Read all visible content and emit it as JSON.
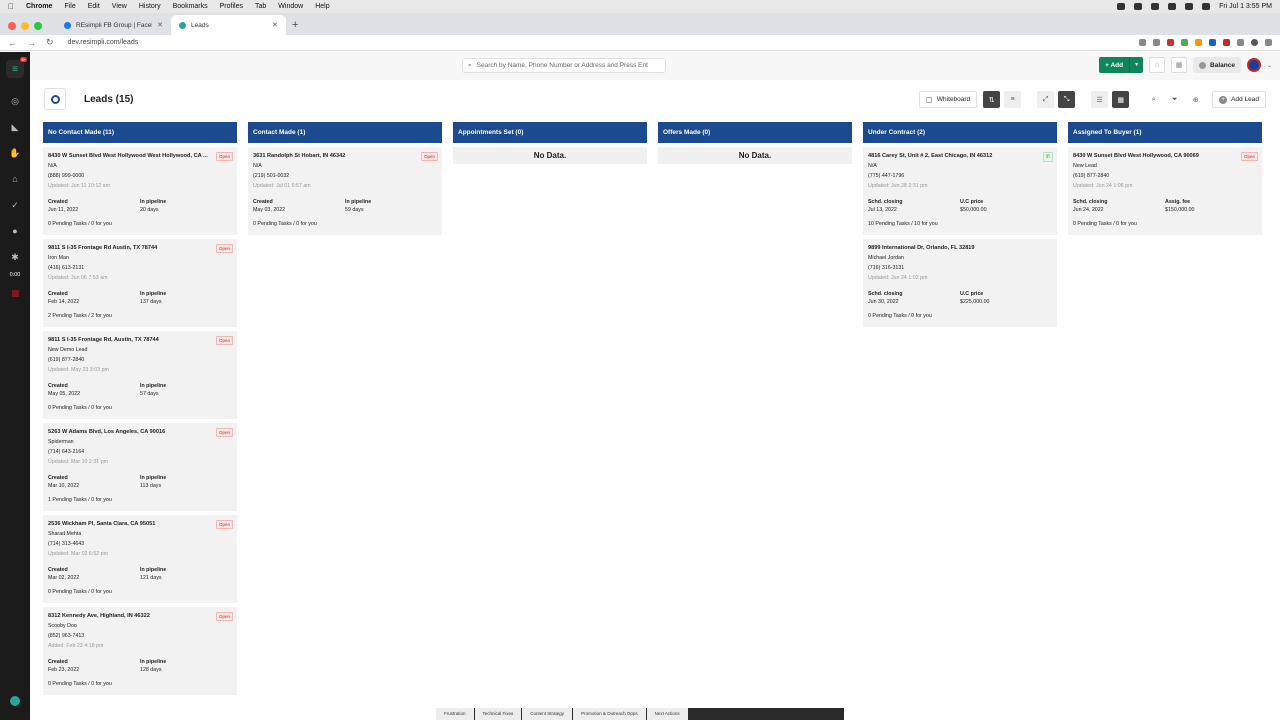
{
  "macbar": {
    "app": "Chrome",
    "menus": [
      "File",
      "Edit",
      "View",
      "History",
      "Bookmarks",
      "Profiles",
      "Tab",
      "Window",
      "Help"
    ],
    "clock": "Fri Jul 1  3:55 PM"
  },
  "browser": {
    "tabs": [
      {
        "title": "REsimpli FB Group | Facebook",
        "active": false
      },
      {
        "title": "Leads",
        "active": true
      }
    ],
    "url": "dev.resimpli.com/leads"
  },
  "header": {
    "search_placeholder": "Search by Name, Phone Number or Address and Press Ent",
    "add_label": "Add",
    "balance_label": "Balance"
  },
  "sidebar": {
    "notif_badge": "9+",
    "timer": "0:00"
  },
  "page": {
    "title": "Leads (15)",
    "whiteboard_label": "Whiteboard",
    "add_lead_label": "Add Lead"
  },
  "columns": [
    {
      "title": "No Contact Made (11)",
      "no_data": "",
      "cards": [
        {
          "address": "8430 W Sunset Blvd West Hollywood West Hollywood, CA ...",
          "name": "N/A",
          "phone": "(888) 999-0000",
          "updated": "Updated: Jun 11 10:12 am",
          "badge": "Open",
          "k1": "Created",
          "v1": "Jun 11, 2022",
          "k2": "In pipeline",
          "v2": "20 days",
          "tasks": "0 Pending Tasks / 0 for you"
        },
        {
          "address": "9811 S I-35 Frontage Rd Austin, TX 78744",
          "name": "Iron Man",
          "phone": "(416) 613-2131",
          "updated": "Updated: Jun 06 7:53 am",
          "badge": "Open",
          "k1": "Created",
          "v1": "Feb 14, 2022",
          "k2": "In pipeline",
          "v2": "137 days",
          "tasks": "2 Pending Tasks / 2 for you"
        },
        {
          "address": "9811 S I-35 Frontage Rd, Austin, TX 78744",
          "name": "New Demo Lead",
          "phone": "(619) 877-2840",
          "updated": "Updated: May 23 3:03 pm",
          "badge": "Open",
          "k1": "Created",
          "v1": "May 05, 2022",
          "k2": "In pipeline",
          "v2": "57 days",
          "tasks": "0 Pending Tasks / 0 for you"
        },
        {
          "address": "5263 W Adams Blvd, Los Angeles, CA 90016",
          "name": "Spiderman",
          "phone": "(714) 643-2164",
          "updated": "Updated: Mar 10 2:31 pm",
          "badge": "Open",
          "k1": "Created",
          "v1": "Mar 10, 2022",
          "k2": "In pipeline",
          "v2": "113 days",
          "tasks": "1 Pending Tasks / 0 for you"
        },
        {
          "address": "2536 Wickham Pl, Santa Clara, CA 95051",
          "name": "Sharad Mehta",
          "phone": "(714) 313-4643",
          "updated": "Updated: Mar 02 6:52 pm",
          "badge": "Open",
          "k1": "Created",
          "v1": "Mar 02, 2022",
          "k2": "In pipeline",
          "v2": "121 days",
          "tasks": "0 Pending Tasks / 0 for you"
        },
        {
          "address": "8312 Kennedy Ave, Highland, IN 46322",
          "name": "Scooby Doo",
          "phone": "(852) 963-7413",
          "updated": "Added: Feb 23 4:18 pm",
          "badge": "Open",
          "k1": "Created",
          "v1": "Feb 23, 2022",
          "k2": "In pipeline",
          "v2": "128 days",
          "tasks": "0 Pending Tasks / 0 for you"
        }
      ]
    },
    {
      "title": "Contact Made (1)",
      "no_data": "",
      "cards": [
        {
          "address": "3631 Randolph St Hobart, IN 46342",
          "name": "N/A",
          "phone": "(219) 501-0032",
          "updated": "Updated: Jul 01 6:57 am",
          "badge": "Open",
          "k1": "Created",
          "v1": "May 03, 2022",
          "k2": "In pipeline",
          "v2": "59 days",
          "tasks": "0 Pending Tasks / 0 for you"
        }
      ]
    },
    {
      "title": "Appointments Set (0)",
      "no_data": "No Data.",
      "cards": []
    },
    {
      "title": "Offers Made (0)",
      "no_data": "No Data.",
      "cards": []
    },
    {
      "title": "Under Contract (2)",
      "no_data": "",
      "cards": [
        {
          "address": "4816 Carey St, Unit # 2, East Chicago, IN 46312",
          "name": "N/A",
          "phone": "(775) 447-1796",
          "updated": "Updated: Jun 28 2:31 pm",
          "badge": "✆",
          "k1": "Schd. closing",
          "v1": "Jul 13, 2022",
          "k2": "U.C price",
          "v2": "$50,000.00",
          "tasks": "10 Pending Tasks / 10 for you"
        },
        {
          "address": "9899 International Dr, Orlando, FL 32819",
          "name": "Michael Jordan",
          "phone": "(716) 316-3131",
          "updated": "Updated: Jun 24 1:02 pm",
          "badge": "",
          "k1": "Schd. closing",
          "v1": "Jun 30, 2022",
          "k2": "U.C price",
          "v2": "$225,000.00",
          "tasks": "0 Pending Tasks / 0 for you"
        }
      ]
    },
    {
      "title": "Assigned To Buyer (1)",
      "no_data": "",
      "cards": [
        {
          "address": "8430 W Sunset Blvd West Hollywood, CA 90069",
          "name": "New Lead",
          "phone": "(619) 877-2840",
          "updated": "Updated: Jun 24 1:06 pm",
          "badge": "Open",
          "k1": "Schd. closing",
          "v1": "Jun 24, 2022",
          "k2": "Assig. fee",
          "v2": "$150,000.00",
          "tasks": "0 Pending Tasks / 0 for you"
        }
      ]
    }
  ],
  "bottom_tabs": [
    "Frustration",
    "Technical Fixes",
    "Content Strategy",
    "Promotion & Outreach Opps",
    "Next Actions"
  ]
}
